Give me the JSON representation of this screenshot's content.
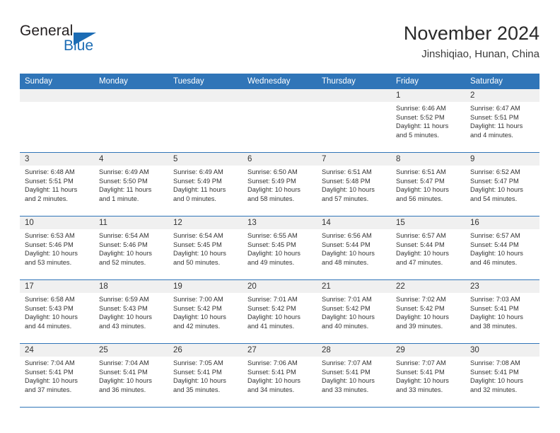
{
  "brand": {
    "name_part1": "General",
    "name_part2": "Blue",
    "accent_color": "#1c6cb4"
  },
  "header": {
    "title": "November 2024",
    "subtitle": "Jinshiqiao, Hunan, China"
  },
  "theme": {
    "header_row_bg": "#3075b8",
    "date_band_bg": "#f0f0f0",
    "grid_line": "#3075b8",
    "text": "#333333"
  },
  "weekday_headers": [
    "Sunday",
    "Monday",
    "Tuesday",
    "Wednesday",
    "Thursday",
    "Friday",
    "Saturday"
  ],
  "weeks": [
    [
      {
        "day": "",
        "sunrise": "",
        "sunset": "",
        "daylight1": "",
        "daylight2": ""
      },
      {
        "day": "",
        "sunrise": "",
        "sunset": "",
        "daylight1": "",
        "daylight2": ""
      },
      {
        "day": "",
        "sunrise": "",
        "sunset": "",
        "daylight1": "",
        "daylight2": ""
      },
      {
        "day": "",
        "sunrise": "",
        "sunset": "",
        "daylight1": "",
        "daylight2": ""
      },
      {
        "day": "",
        "sunrise": "",
        "sunset": "",
        "daylight1": "",
        "daylight2": ""
      },
      {
        "day": "1",
        "sunrise": "Sunrise: 6:46 AM",
        "sunset": "Sunset: 5:52 PM",
        "daylight1": "Daylight: 11 hours",
        "daylight2": "and 5 minutes."
      },
      {
        "day": "2",
        "sunrise": "Sunrise: 6:47 AM",
        "sunset": "Sunset: 5:51 PM",
        "daylight1": "Daylight: 11 hours",
        "daylight2": "and 4 minutes."
      }
    ],
    [
      {
        "day": "3",
        "sunrise": "Sunrise: 6:48 AM",
        "sunset": "Sunset: 5:51 PM",
        "daylight1": "Daylight: 11 hours",
        "daylight2": "and 2 minutes."
      },
      {
        "day": "4",
        "sunrise": "Sunrise: 6:49 AM",
        "sunset": "Sunset: 5:50 PM",
        "daylight1": "Daylight: 11 hours",
        "daylight2": "and 1 minute."
      },
      {
        "day": "5",
        "sunrise": "Sunrise: 6:49 AM",
        "sunset": "Sunset: 5:49 PM",
        "daylight1": "Daylight: 11 hours",
        "daylight2": "and 0 minutes."
      },
      {
        "day": "6",
        "sunrise": "Sunrise: 6:50 AM",
        "sunset": "Sunset: 5:49 PM",
        "daylight1": "Daylight: 10 hours",
        "daylight2": "and 58 minutes."
      },
      {
        "day": "7",
        "sunrise": "Sunrise: 6:51 AM",
        "sunset": "Sunset: 5:48 PM",
        "daylight1": "Daylight: 10 hours",
        "daylight2": "and 57 minutes."
      },
      {
        "day": "8",
        "sunrise": "Sunrise: 6:51 AM",
        "sunset": "Sunset: 5:47 PM",
        "daylight1": "Daylight: 10 hours",
        "daylight2": "and 56 minutes."
      },
      {
        "day": "9",
        "sunrise": "Sunrise: 6:52 AM",
        "sunset": "Sunset: 5:47 PM",
        "daylight1": "Daylight: 10 hours",
        "daylight2": "and 54 minutes."
      }
    ],
    [
      {
        "day": "10",
        "sunrise": "Sunrise: 6:53 AM",
        "sunset": "Sunset: 5:46 PM",
        "daylight1": "Daylight: 10 hours",
        "daylight2": "and 53 minutes."
      },
      {
        "day": "11",
        "sunrise": "Sunrise: 6:54 AM",
        "sunset": "Sunset: 5:46 PM",
        "daylight1": "Daylight: 10 hours",
        "daylight2": "and 52 minutes."
      },
      {
        "day": "12",
        "sunrise": "Sunrise: 6:54 AM",
        "sunset": "Sunset: 5:45 PM",
        "daylight1": "Daylight: 10 hours",
        "daylight2": "and 50 minutes."
      },
      {
        "day": "13",
        "sunrise": "Sunrise: 6:55 AM",
        "sunset": "Sunset: 5:45 PM",
        "daylight1": "Daylight: 10 hours",
        "daylight2": "and 49 minutes."
      },
      {
        "day": "14",
        "sunrise": "Sunrise: 6:56 AM",
        "sunset": "Sunset: 5:44 PM",
        "daylight1": "Daylight: 10 hours",
        "daylight2": "and 48 minutes."
      },
      {
        "day": "15",
        "sunrise": "Sunrise: 6:57 AM",
        "sunset": "Sunset: 5:44 PM",
        "daylight1": "Daylight: 10 hours",
        "daylight2": "and 47 minutes."
      },
      {
        "day": "16",
        "sunrise": "Sunrise: 6:57 AM",
        "sunset": "Sunset: 5:44 PM",
        "daylight1": "Daylight: 10 hours",
        "daylight2": "and 46 minutes."
      }
    ],
    [
      {
        "day": "17",
        "sunrise": "Sunrise: 6:58 AM",
        "sunset": "Sunset: 5:43 PM",
        "daylight1": "Daylight: 10 hours",
        "daylight2": "and 44 minutes."
      },
      {
        "day": "18",
        "sunrise": "Sunrise: 6:59 AM",
        "sunset": "Sunset: 5:43 PM",
        "daylight1": "Daylight: 10 hours",
        "daylight2": "and 43 minutes."
      },
      {
        "day": "19",
        "sunrise": "Sunrise: 7:00 AM",
        "sunset": "Sunset: 5:42 PM",
        "daylight1": "Daylight: 10 hours",
        "daylight2": "and 42 minutes."
      },
      {
        "day": "20",
        "sunrise": "Sunrise: 7:01 AM",
        "sunset": "Sunset: 5:42 PM",
        "daylight1": "Daylight: 10 hours",
        "daylight2": "and 41 minutes."
      },
      {
        "day": "21",
        "sunrise": "Sunrise: 7:01 AM",
        "sunset": "Sunset: 5:42 PM",
        "daylight1": "Daylight: 10 hours",
        "daylight2": "and 40 minutes."
      },
      {
        "day": "22",
        "sunrise": "Sunrise: 7:02 AM",
        "sunset": "Sunset: 5:42 PM",
        "daylight1": "Daylight: 10 hours",
        "daylight2": "and 39 minutes."
      },
      {
        "day": "23",
        "sunrise": "Sunrise: 7:03 AM",
        "sunset": "Sunset: 5:41 PM",
        "daylight1": "Daylight: 10 hours",
        "daylight2": "and 38 minutes."
      }
    ],
    [
      {
        "day": "24",
        "sunrise": "Sunrise: 7:04 AM",
        "sunset": "Sunset: 5:41 PM",
        "daylight1": "Daylight: 10 hours",
        "daylight2": "and 37 minutes."
      },
      {
        "day": "25",
        "sunrise": "Sunrise: 7:04 AM",
        "sunset": "Sunset: 5:41 PM",
        "daylight1": "Daylight: 10 hours",
        "daylight2": "and 36 minutes."
      },
      {
        "day": "26",
        "sunrise": "Sunrise: 7:05 AM",
        "sunset": "Sunset: 5:41 PM",
        "daylight1": "Daylight: 10 hours",
        "daylight2": "and 35 minutes."
      },
      {
        "day": "27",
        "sunrise": "Sunrise: 7:06 AM",
        "sunset": "Sunset: 5:41 PM",
        "daylight1": "Daylight: 10 hours",
        "daylight2": "and 34 minutes."
      },
      {
        "day": "28",
        "sunrise": "Sunrise: 7:07 AM",
        "sunset": "Sunset: 5:41 PM",
        "daylight1": "Daylight: 10 hours",
        "daylight2": "and 33 minutes."
      },
      {
        "day": "29",
        "sunrise": "Sunrise: 7:07 AM",
        "sunset": "Sunset: 5:41 PM",
        "daylight1": "Daylight: 10 hours",
        "daylight2": "and 33 minutes."
      },
      {
        "day": "30",
        "sunrise": "Sunrise: 7:08 AM",
        "sunset": "Sunset: 5:41 PM",
        "daylight1": "Daylight: 10 hours",
        "daylight2": "and 32 minutes."
      }
    ]
  ]
}
